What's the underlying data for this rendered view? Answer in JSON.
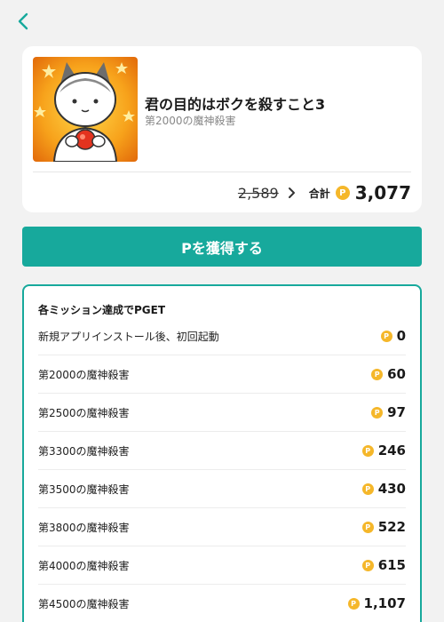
{
  "header": {
    "back_icon": "chevron-left-icon"
  },
  "product": {
    "title": "君の目的はボクを殺すこと3",
    "subtitle": "第2000の魔神殺害",
    "old_price": "2,589",
    "total_label": "合計",
    "total_value": "3,077",
    "coin_symbol": "P"
  },
  "action": {
    "button_label": "Pを獲得する"
  },
  "missions": {
    "header": "各ミッション達成でPGET",
    "coin_symbol": "P",
    "items": [
      {
        "label": "新規アプリインストール後、初回起動",
        "value": "0"
      },
      {
        "label": "第2000の魔神殺害",
        "value": "60"
      },
      {
        "label": "第2500の魔神殺害",
        "value": "97"
      },
      {
        "label": "第3300の魔神殺害",
        "value": "246"
      },
      {
        "label": "第3500の魔神殺害",
        "value": "430"
      },
      {
        "label": "第3800の魔神殺害",
        "value": "522"
      },
      {
        "label": "第4000の魔神殺害",
        "value": "615"
      },
      {
        "label": "第4500の魔神殺害",
        "value": "1,107"
      }
    ]
  },
  "colors": {
    "accent": "#17a99c",
    "coin": "#f5b72a",
    "background": "#f2f2f2"
  }
}
